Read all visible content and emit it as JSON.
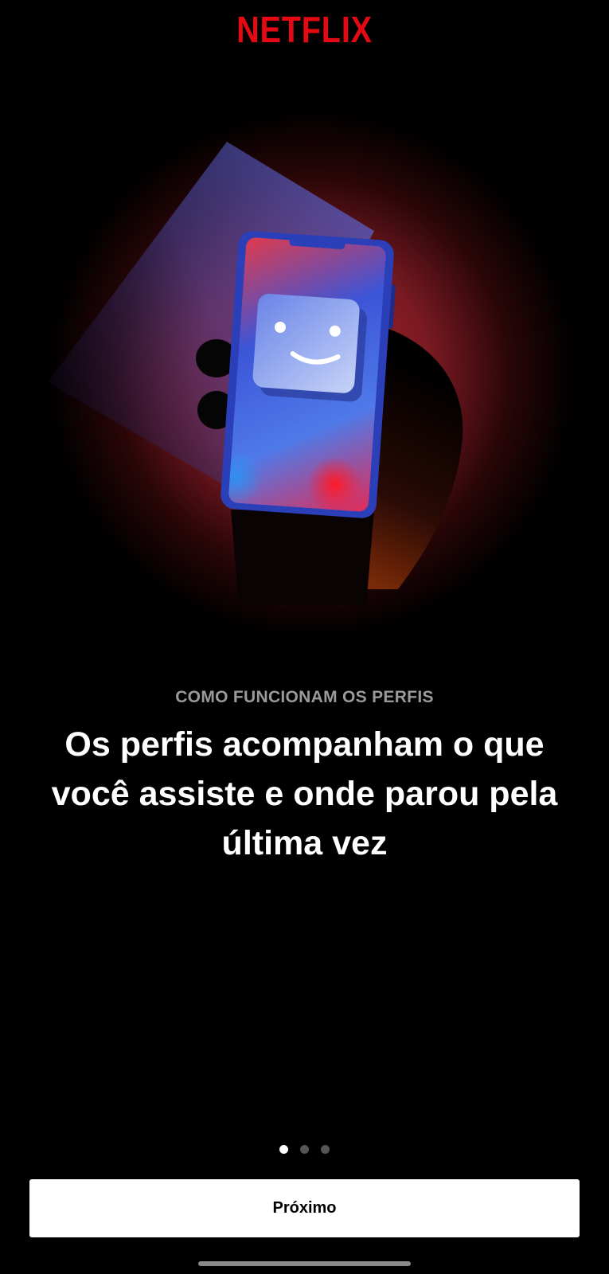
{
  "app": {
    "brand": "NETFLIX",
    "brand_color": "#E50914"
  },
  "onboarding": {
    "eyebrow": "COMO FUNCIONAM OS PERFIS",
    "headline": "Os perfis acompanham o que você assiste e onde parou pela última vez",
    "illustration_icon": "phone-profile-smiley-illustration",
    "page_indicator": {
      "total": 3,
      "active_index": 0
    },
    "next_button_label": "Próximo"
  }
}
